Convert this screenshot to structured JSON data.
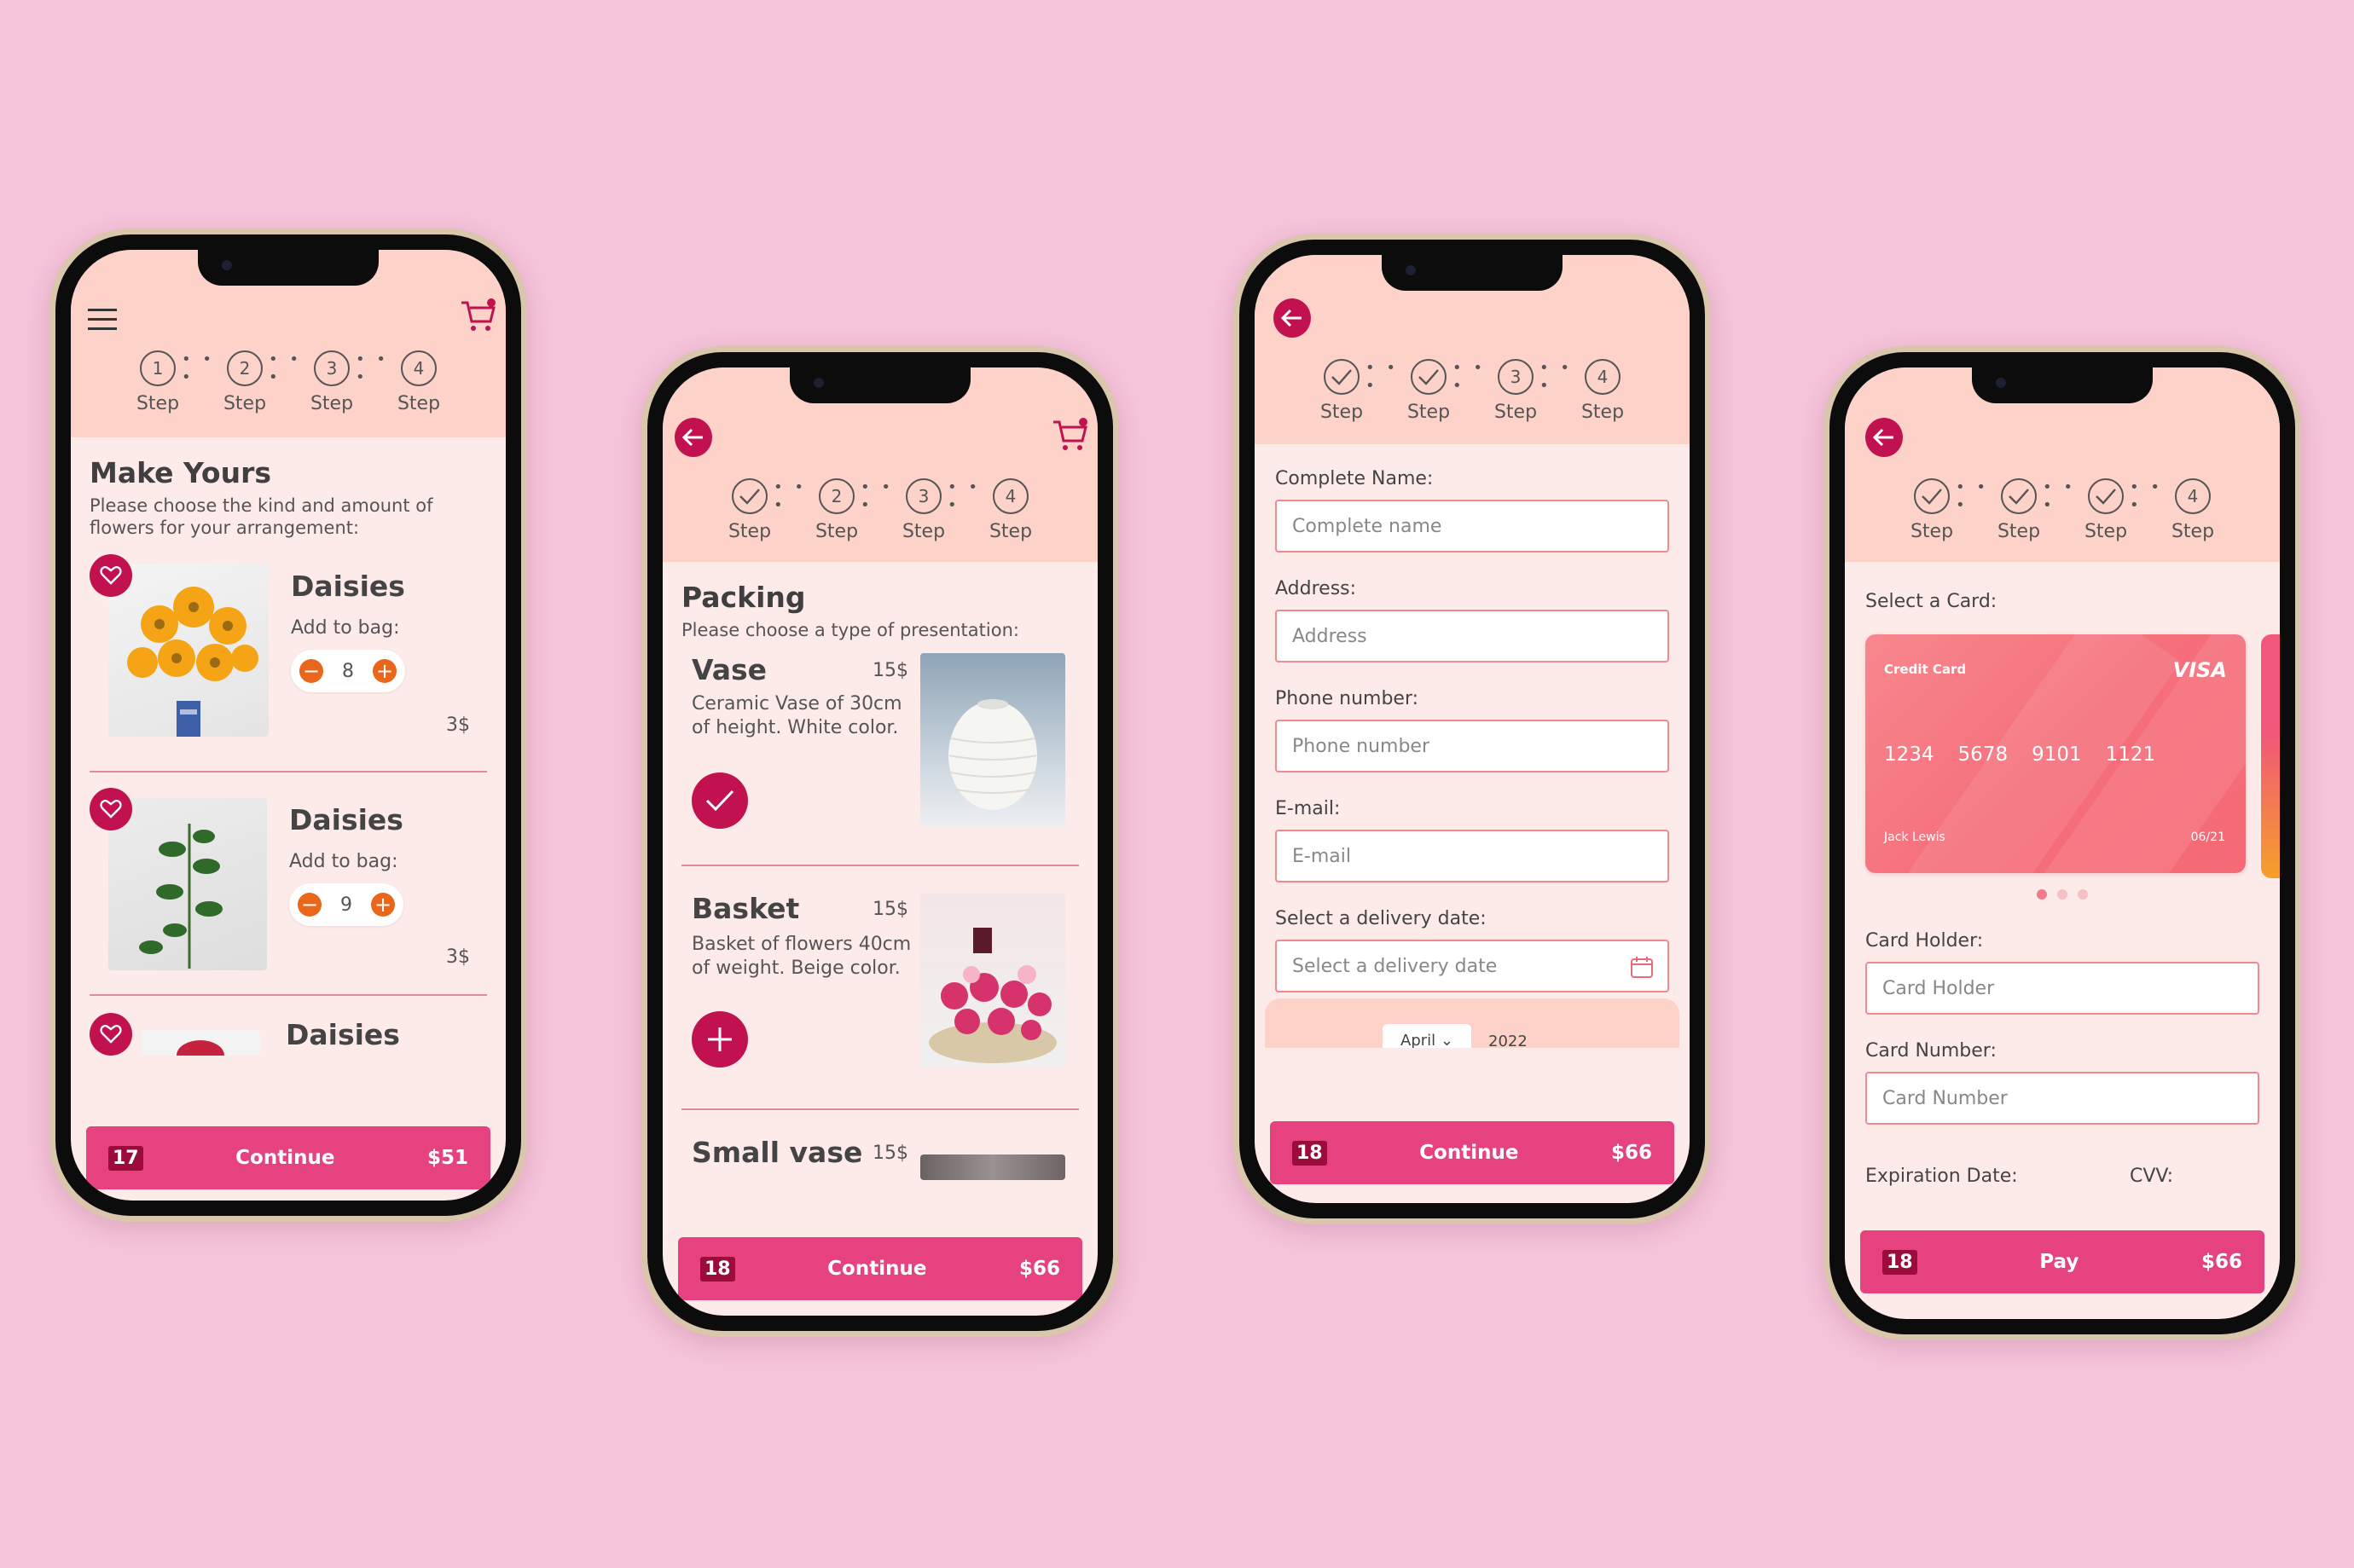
{
  "colors": {
    "background": "#f5c4da",
    "accent": "#c1124f",
    "button": "#e5427f",
    "header": "#fcd2c9",
    "screen": "#fdebe9",
    "stepper": "#e9661a"
  },
  "steps": {
    "labels": [
      "Step",
      "Step",
      "Step",
      "Step"
    ],
    "numbers": [
      "1",
      "2",
      "3",
      "4"
    ]
  },
  "screen1": {
    "title": "Make Yours",
    "subtitle": "Please choose the kind and amount of flowers for your arrangement:",
    "items": [
      {
        "name": "Daisies",
        "add_label": "Add to bag:",
        "quantity": "8",
        "price": "3$"
      },
      {
        "name": "Daisies",
        "add_label": "Add to bag:",
        "quantity": "9",
        "price": "3$"
      },
      {
        "name": "Daisies"
      }
    ],
    "bar": {
      "count": "17",
      "label": "Continue",
      "total": "$51"
    }
  },
  "screen2": {
    "title": "Packing",
    "subtitle": "Please choose a type of presentation:",
    "options": [
      {
        "name": "Vase",
        "price": "15$",
        "description": "Ceramic Vase of 30cm of height. White color.",
        "state": "selected"
      },
      {
        "name": "Basket",
        "price": "15$",
        "description": "Basket of flowers 40cm of weight. Beige color.",
        "state": "add"
      },
      {
        "name": "Small vase",
        "price": "15$"
      }
    ],
    "bar": {
      "count": "18",
      "label": "Continue",
      "total": "$66"
    }
  },
  "screen3": {
    "fields": [
      {
        "label": "Complete Name:",
        "placeholder": "Complete name"
      },
      {
        "label": "Address:",
        "placeholder": "Address"
      },
      {
        "label": "Phone number:",
        "placeholder": "Phone number"
      },
      {
        "label": "E-mail:",
        "placeholder": "E-mail"
      },
      {
        "label": "Select a delivery date:",
        "placeholder": "Select a delivery date"
      }
    ],
    "calendar": {
      "month": "April",
      "year": "2022"
    },
    "bar": {
      "count": "18",
      "label": "Continue",
      "total": "$66"
    }
  },
  "screen4": {
    "select_label": "Select a Card:",
    "card": {
      "type": "Credit Card",
      "brand": "VISA",
      "groups": [
        "1234",
        "5678",
        "9101",
        "1121"
      ],
      "holder": "Jack Lewis",
      "expiry": "06/21"
    },
    "fields": [
      {
        "label": "Card Holder:",
        "placeholder": "Card Holder"
      },
      {
        "label": "Card Number:",
        "placeholder": "Card Number"
      }
    ],
    "expiration_label": "Expiration Date:",
    "cvv_label": "CVV:",
    "bar": {
      "count": "18",
      "label": "Pay",
      "total": "$66"
    }
  }
}
